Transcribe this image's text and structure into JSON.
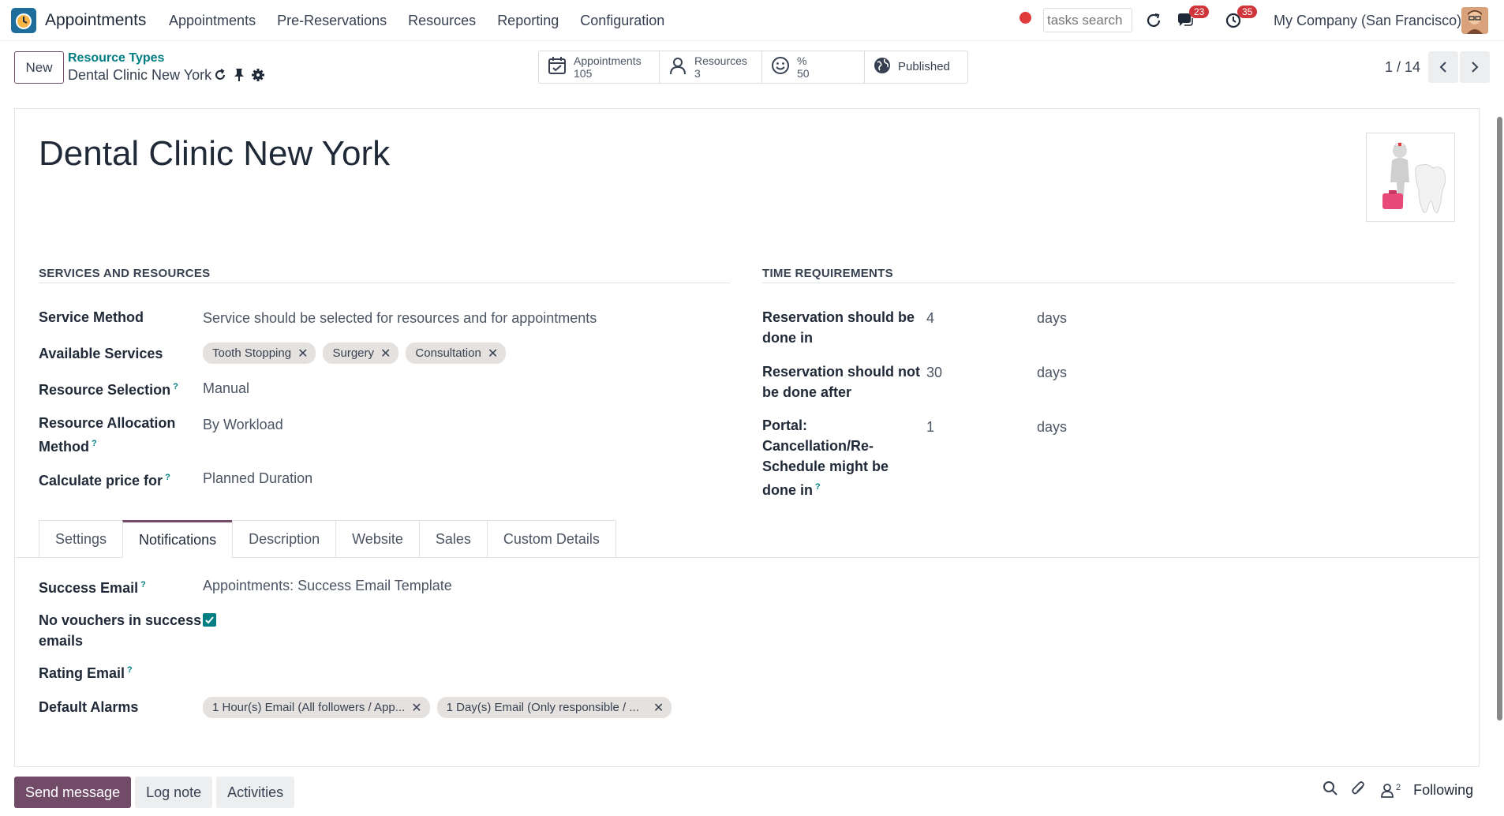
{
  "navbar": {
    "app_name": "Appointments",
    "menu": [
      "Appointments",
      "Pre-Reservations",
      "Resources",
      "Reporting",
      "Configuration"
    ],
    "search_placeholder": "tasks search",
    "messages_count": "23",
    "activities_count": "35",
    "company": "My Company (San Francisco)"
  },
  "control": {
    "new_label": "New",
    "breadcrumb_parent": "Resource Types",
    "breadcrumb_current": "Dental Clinic New York",
    "pager": "1 / 14"
  },
  "smart_buttons": [
    {
      "label": "Appointments",
      "value": "105",
      "icon": "calendar-check-icon"
    },
    {
      "label": "Resources",
      "value": "3",
      "icon": "user-icon"
    },
    {
      "label": "%",
      "value": "50",
      "icon": "smiley-icon"
    },
    {
      "label": "Published",
      "value": "",
      "icon": "globe-icon"
    }
  ],
  "record": {
    "title": "Dental Clinic New York"
  },
  "services": {
    "section_title": "SERVICES AND RESOURCES",
    "service_method_label": "Service Method",
    "service_method_value": "Service should be selected for resources and for appointments",
    "available_services_label": "Available Services",
    "available_services": [
      "Tooth Stopping",
      "Surgery",
      "Consultation"
    ],
    "resource_selection_label": "Resource Selection",
    "resource_selection_value": "Manual",
    "resource_allocation_label_1": "Resource Allocation",
    "resource_allocation_label_2": "Method",
    "resource_allocation_value": "By Workload",
    "price_label": "Calculate price for",
    "price_value": "Planned Duration",
    "help_mark": "?"
  },
  "time": {
    "section_title": "TIME REQUIREMENTS",
    "rows": [
      {
        "label_lines": [
          "Reservation should be",
          "done in"
        ],
        "value": "4",
        "unit": "days"
      },
      {
        "label_lines": [
          "Reservation should not",
          "be done after"
        ],
        "value": "30",
        "unit": "days"
      },
      {
        "label_lines": [
          "Portal:",
          "Cancellation/Re-",
          "Schedule might be",
          "done in"
        ],
        "value": "1",
        "unit": "days"
      }
    ]
  },
  "tabs": [
    "Settings",
    "Notifications",
    "Description",
    "Website",
    "Sales",
    "Custom Details"
  ],
  "notifications": {
    "success_email_label": "Success Email",
    "success_email_value": "Appointments: Success Email Template",
    "no_vouchers_label_1": "No vouchers in success",
    "no_vouchers_label_2": "emails",
    "no_vouchers_checked": true,
    "rating_email_label": "Rating Email",
    "default_alarms_label": "Default Alarms",
    "default_alarms": [
      "1 Hour(s) Email (All followers / App...",
      "1 Day(s) Email (Only responsible / ..."
    ]
  },
  "chatter": {
    "send_message": "Send message",
    "log_note": "Log note",
    "activities": "Activities",
    "followers_count": "2",
    "following": "Following"
  },
  "colors": {
    "brand": "#714b67",
    "link": "#017e84",
    "badge": "#d0353b"
  }
}
